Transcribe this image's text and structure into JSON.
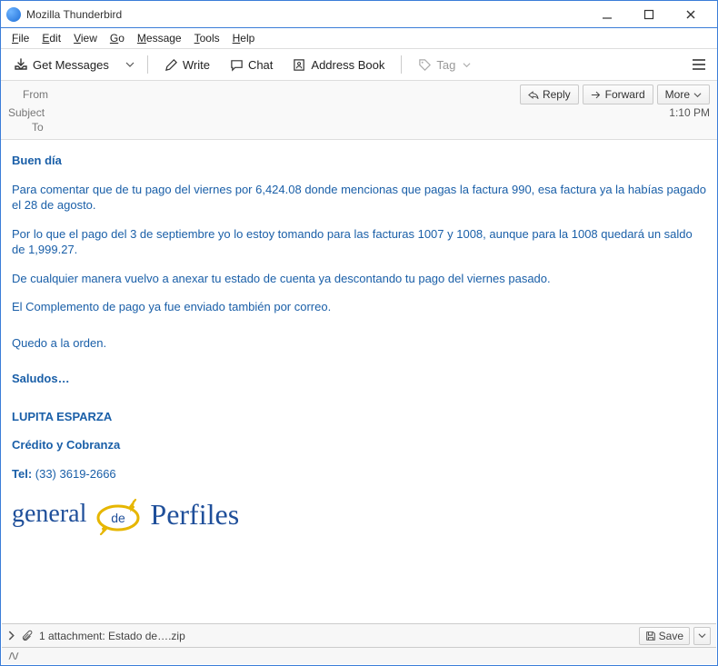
{
  "window": {
    "title": "Mozilla Thunderbird"
  },
  "menubar": {
    "file": "File",
    "edit": "Edit",
    "view": "View",
    "go": "Go",
    "message": "Message",
    "tools": "Tools",
    "help": "Help"
  },
  "toolbar": {
    "get_messages": "Get Messages",
    "write": "Write",
    "chat": "Chat",
    "address_book": "Address Book",
    "tag": "Tag"
  },
  "header": {
    "from_label": "From",
    "subject_label": "Subject",
    "to_label": "To",
    "time": "1:10 PM",
    "reply": "Reply",
    "forward": "Forward",
    "more": "More"
  },
  "body": {
    "greeting": "Buen día",
    "p1": "Para comentar que de tu pago del viernes por  6,424.08 donde mencionas que pagas la factura 990, esa factura ya la habías pagado el 28 de agosto.",
    "p2": "Por lo que el pago del 3 de septiembre yo lo estoy tomando para las facturas 1007 y 1008, aunque para la 1008 quedará un saldo de 1,999.27.",
    "p3": "De cualquier manera vuelvo a anexar tu estado de cuenta ya descontando tu pago del viernes pasado.",
    "p4": "El Complemento de pago ya fue enviado también por correo.",
    "p5": "Quedo a la orden.",
    "saludos": "Saludos…",
    "name": "LUPITA ESPARZA",
    "dept": "Crédito y Cobranza",
    "tel_label": "Tel:",
    "tel_value": " (33) 3619-2666",
    "logo_word1": "general",
    "logo_de": "de",
    "logo_word2": "Perfiles"
  },
  "attachment": {
    "expand": ">",
    "text": "1 attachment: Estado de….zip",
    "save": "Save"
  }
}
